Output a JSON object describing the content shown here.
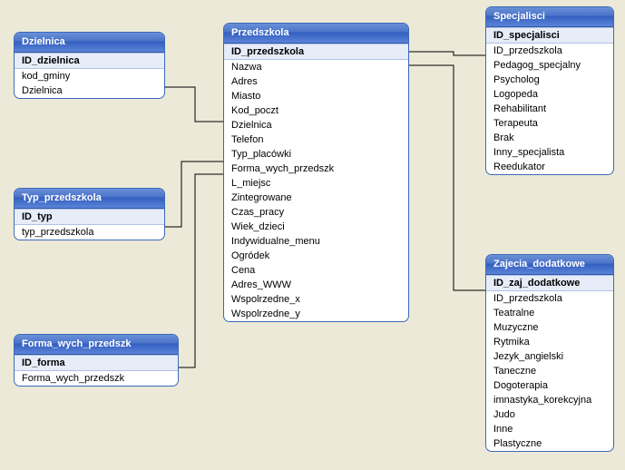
{
  "tables": {
    "dzielnica": {
      "title": "Dzielnica",
      "pk": "ID_dzielnica",
      "fields": [
        "kod_gminy",
        "Dzielnica"
      ]
    },
    "typ_przedszkola": {
      "title": "Typ_przedszkola",
      "pk": "ID_typ",
      "fields": [
        "typ_przedszkola"
      ]
    },
    "forma": {
      "title": "Forma_wych_przedszk",
      "pk": "ID_forma",
      "fields": [
        "Forma_wych_przedszk"
      ]
    },
    "przedszkola": {
      "title": "Przedszkola",
      "pk": "ID_przedszkola",
      "fields": [
        "Nazwa",
        "Adres",
        "Miasto",
        "Kod_poczt",
        "Dzielnica",
        "Telefon",
        "Typ_placówki",
        "Forma_wych_przedszk",
        "L_miejsc",
        "Zintegrowane",
        "Czas_pracy",
        "Wiek_dzieci",
        "Indywidualne_menu",
        "Ogródek",
        "Cena",
        "Adres_WWW",
        "Wspolrzedne_x",
        "Wspolrzedne_y"
      ]
    },
    "specjalisci": {
      "title": "Specjalisci",
      "pk": "ID_specjalisci",
      "fields": [
        "ID_przedszkola",
        "Pedagog_specjalny",
        "Psycholog",
        "Logopeda",
        "Rehabilitant",
        "Terapeuta",
        "Brak",
        "Inny_specjalista",
        "Reedukator"
      ]
    },
    "zajecia": {
      "title": "Zajecia_dodatkowe",
      "pk": "ID_zaj_dodatkowe",
      "fields": [
        "ID_przedszkola",
        "Teatralne",
        "Muzyczne",
        "Rytmika",
        "Jezyk_angielski",
        "Taneczne",
        "Dogoterapia",
        "imnastyka_korekcyjna",
        "Judo",
        "Inne",
        "Plastyczne"
      ]
    }
  }
}
